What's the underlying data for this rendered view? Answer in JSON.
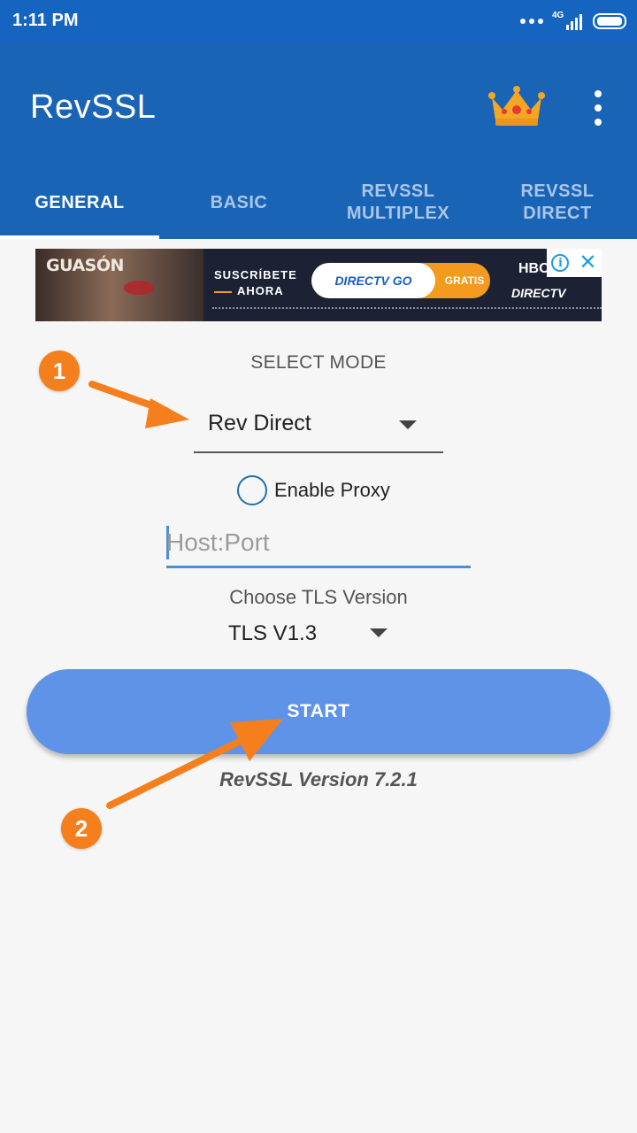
{
  "status_bar": {
    "time": "1:11 PM",
    "network": "4G"
  },
  "app": {
    "title": "RevSSL"
  },
  "tabs": [
    {
      "label": "GENERAL"
    },
    {
      "label": "BASIC"
    },
    {
      "label": "REVSSL\nMULTIPLEX"
    },
    {
      "label": "REVSSL\nDIRECT"
    }
  ],
  "ad": {
    "title": "GUASÓN",
    "line1": "SUSCRÍBETE",
    "line2": "AHORA",
    "brand": "DIRECTV GO",
    "cta": "GRATIS",
    "hbo": "HBO",
    "brand2": "DIRECTV"
  },
  "form": {
    "select_mode_label": "SELECT MODE",
    "mode_value": "Rev Direct",
    "proxy_label": "Enable Proxy",
    "host_placeholder": "Host:Port",
    "host_value": "",
    "tls_label": "Choose TLS Version",
    "tls_value": "TLS V1.3",
    "start_label": "START",
    "version_text": "RevSSL Version 7.2.1"
  },
  "annotations": {
    "step1": "1",
    "step2": "2"
  },
  "colors": {
    "status_bar": "#1565c0",
    "app_bar": "#1a64b6",
    "start_button": "#5e93e8",
    "annotation": "#f47f1c"
  }
}
